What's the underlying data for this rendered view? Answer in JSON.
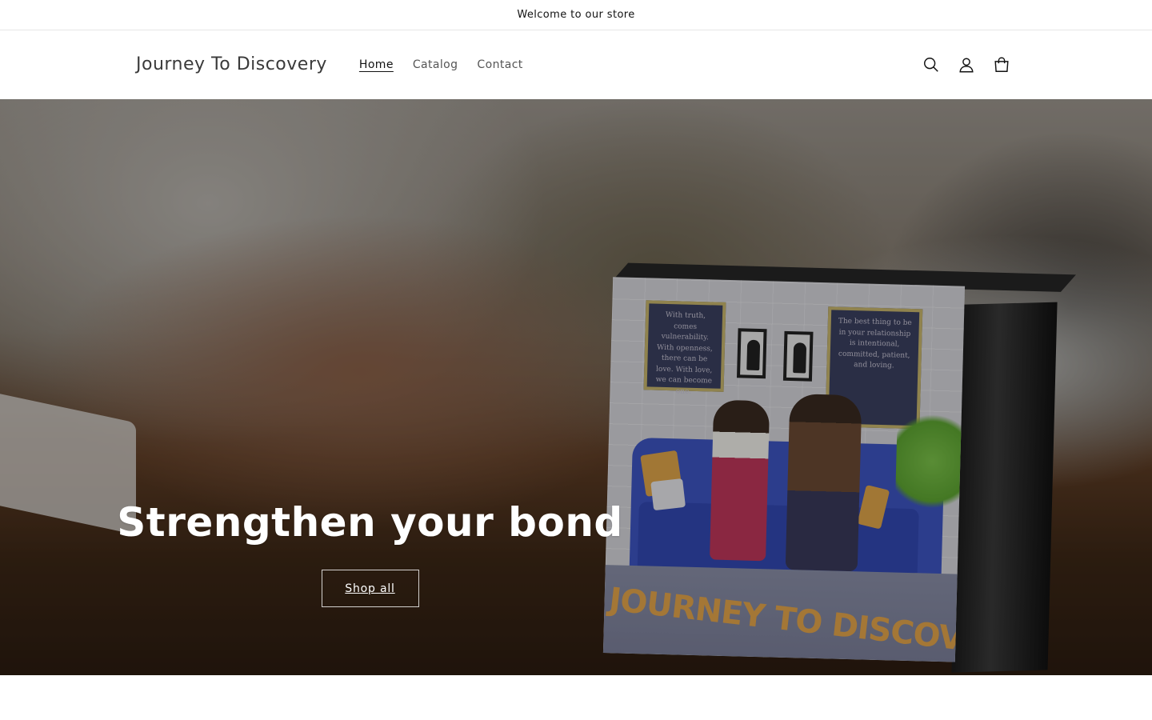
{
  "announcement": {
    "text": "Welcome to our store"
  },
  "header": {
    "logo": "Journey To Discovery",
    "nav": [
      {
        "label": "Home",
        "active": true
      },
      {
        "label": "Catalog",
        "active": false
      },
      {
        "label": "Contact",
        "active": false
      }
    ],
    "icons": [
      "search-icon",
      "account-icon",
      "cart-icon"
    ]
  },
  "hero": {
    "heading": "Strengthen your bond",
    "button_label": "Shop all",
    "image": {
      "box_title": "JOURNEY TO DISCOVERY",
      "frame_left_text": "With truth, comes vulnerability. With openness, there can be love. With love, we can become one.",
      "frame_right_text": "The best thing to be in your relationship is intentional, committed, patient, and loving."
    }
  }
}
